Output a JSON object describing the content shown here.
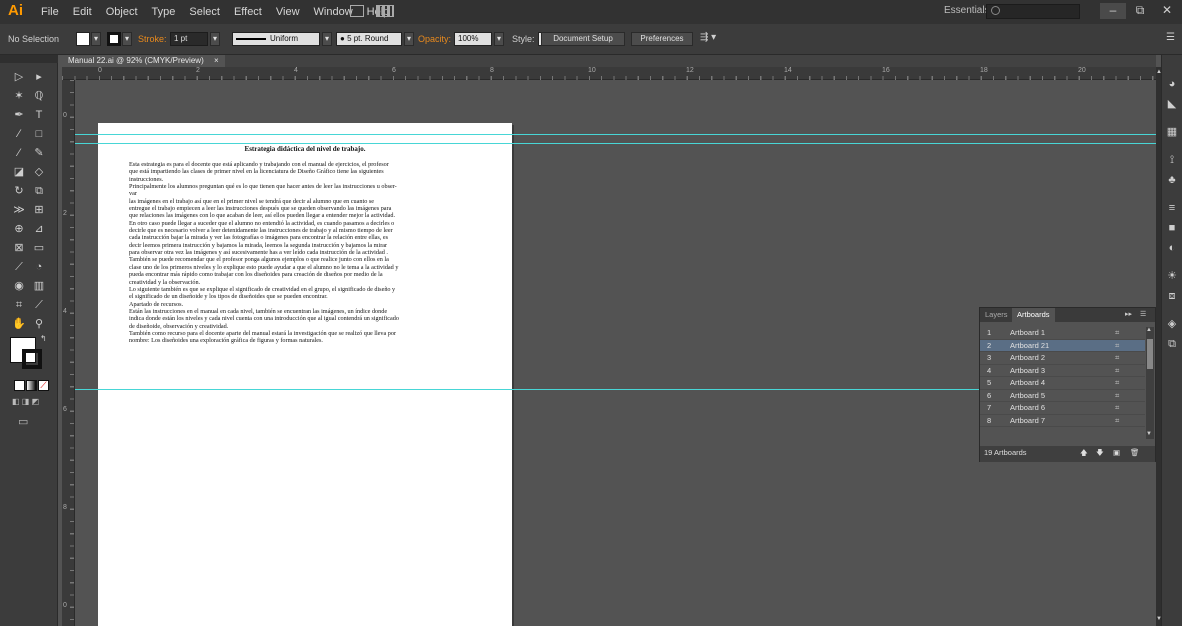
{
  "app": {
    "logo": "Ai",
    "menus": [
      "File",
      "Edit",
      "Object",
      "Type",
      "Select",
      "Effect",
      "View",
      "Window",
      "Help"
    ],
    "workspace": "Essentials",
    "window_controls": [
      "–",
      "⧉",
      "✕"
    ]
  },
  "control_bar": {
    "selection": "No Selection",
    "stroke_label": "Stroke:",
    "stroke_weight": "1 pt",
    "stroke_profile": "Uniform",
    "brush": "5 pt. Round",
    "opacity_label": "Opacity:",
    "opacity_value": "100%",
    "style_label": "Style:",
    "document_setup": "Document Setup",
    "preferences": "Preferences"
  },
  "document_tab": {
    "title": "Manual 22.ai @ 92% (CMYK/Preview)",
    "close": "×"
  },
  "rulers": {
    "horizontal": [
      "0",
      "2",
      "4",
      "6",
      "8",
      "10",
      "12",
      "14",
      "16",
      "18",
      "20"
    ],
    "vertical": [
      "0",
      "2",
      "4",
      "6",
      "8",
      "0"
    ]
  },
  "document": {
    "title": "Estrategia didáctica del nivel de trabajo.",
    "lines": [
      "Esta estrategia es para el docente que está aplicando y trabajando con el manual de ejercicios, el profesor",
      "que está impartiendo las clases de primer nivel en la licenciatura de Diseño Gráfico tiene las siguientes",
      "instrucciones.",
      "Principalmente los alumnos preguntan qué es lo que tienen que hacer antes de leer las instrucciones u obser-",
      "var",
      "las imágenes en el trabajo así que en el primer nivel se tendrá que decir al alumno que en cuanto se",
      "entregue el trabajo empiecen a leer las instrucciones después que se queden observando las imágenes para",
      "que relaciones las imágenes con lo que acaban de leer, así ellos pueden llegar a entender mejor la actividad.",
      "En otro caso puede llegar a suceder que el alumno no entendió la actividad, es cuando pasamos a decirles o",
      "decirle que es necesario volver a leer detenidamente las instrucciones de trabajo y al mismo tiempo de leer",
      "cada instrucción bajar la mirada y ver las fotografías o imágenes para encontrar la relación entre ellas, es",
      "decir leemos primera instrucción y bajamos la mirada, leemos la segunda instrucción y bajamos la mirar",
      "para observar otra vez las imágenes y así sucesivamente has a ver leído cada instrucción de la actividad .",
      "También se puede recomendar que el profesor ponga algunos ejemplos o que realice junto con ellos en la",
      "clase uno de los primeros niveles y lo explique esto puede ayudar a que el alumno no le tema a la actividad y",
      "pueda encontrar más rápido como trabajar con los diseñoides para creación de diseños por medio de la",
      "creatividad y la observación.",
      "Lo siguiente también es que se explique el significado de creatividad en el grupo, el significado de diseño y",
      "el significado de un diseñoide y los tipos de diseñoides que se pueden encontrar.",
      "Apartado de recursos.",
      "Están las instrucciones en el manual en cada nivel, también se encuentran las imágenes, un índice donde",
      "indica donde están los niveles y cada nivel cuenta con una introducción que al igual contendrá un significado",
      "de diseñoide, observación y creatividad.",
      "También como recurso para el docente aparte del manual estará la investigación que se realizó que lleva por",
      "nombre: Los diseñoides una exploración gráfica de figuras y formas naturales."
    ]
  },
  "artboards_panel": {
    "tabs": [
      "Layers",
      "Artboards"
    ],
    "active_tab": "Artboards",
    "rows": [
      {
        "num": "1",
        "name": "Artboard 1"
      },
      {
        "num": "2",
        "name": "Artboard 21"
      },
      {
        "num": "3",
        "name": "Artboard 2"
      },
      {
        "num": "4",
        "name": "Artboard 3"
      },
      {
        "num": "5",
        "name": "Artboard 4"
      },
      {
        "num": "6",
        "name": "Artboard 5"
      },
      {
        "num": "7",
        "name": "Artboard 6"
      },
      {
        "num": "8",
        "name": "Artboard 7"
      }
    ],
    "selected_row": "2",
    "count_label": "19 Artboards"
  },
  "colors": {
    "accent": "#ff9a00",
    "guide": "#48d6d6",
    "selected_row": "#5a6e85"
  }
}
